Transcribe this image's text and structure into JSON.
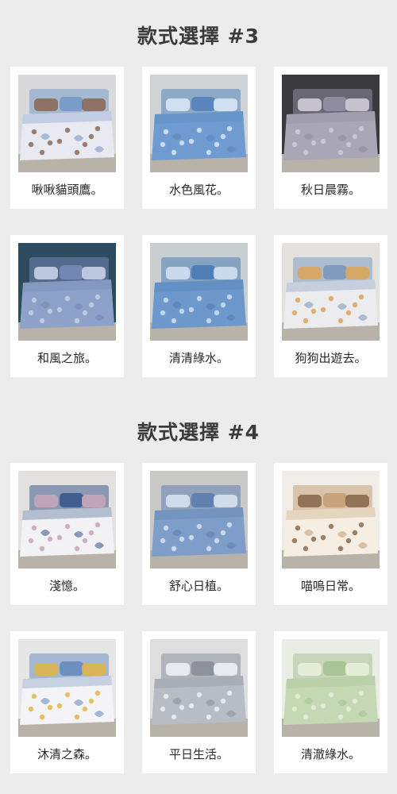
{
  "sections": [
    {
      "title": "款式選擇 #3",
      "items": [
        {
          "name": "啾啾貓頭鷹。",
          "colors": {
            "wall": "#d9d9dc",
            "bed": "#e9e9f1",
            "accent": "#7a9cc8",
            "pattern": "#8b6a5a"
          }
        },
        {
          "name": "水色風花。",
          "colors": {
            "wall": "#cfd3d6",
            "bed": "#6f9bd0",
            "accent": "#5a86bd",
            "pattern": "#d8e6f4"
          }
        },
        {
          "name": "秋日晨霧。",
          "colors": {
            "wall": "#3a3a3c",
            "bed": "#a9a6b6",
            "accent": "#8f8ca0",
            "pattern": "#cfccd8"
          }
        },
        {
          "name": "和風之旅。",
          "colors": {
            "wall": "#2e4a5e",
            "bed": "#8ea2c9",
            "accent": "#7387b3",
            "pattern": "#c6d1e6"
          }
        },
        {
          "name": "清清綠水。",
          "colors": {
            "wall": "#c9cfd0",
            "bed": "#6c98cc",
            "accent": "#4f7db5",
            "pattern": "#cfe0f0"
          }
        },
        {
          "name": "狗狗出遊去。",
          "colors": {
            "wall": "#e4e2df",
            "bed": "#ecebee",
            "accent": "#7f9cc0",
            "pattern": "#d9a55c"
          }
        }
      ]
    },
    {
      "title": "款式選擇 #4",
      "items": [
        {
          "name": "淺憶。",
          "colors": {
            "wall": "#e3e1df",
            "bed": "#f2f2f4",
            "accent": "#3f5e8f",
            "pattern": "#c7a6ba"
          }
        },
        {
          "name": "舒心日植。",
          "colors": {
            "wall": "#c9c9c7",
            "bed": "#7e9ec9",
            "accent": "#5f80b0",
            "pattern": "#d8e2ef"
          }
        },
        {
          "name": "喵嗚日常。",
          "colors": {
            "wall": "#f0ece6",
            "bed": "#f6eee2",
            "accent": "#c7a27a",
            "pattern": "#8a6a4f"
          }
        },
        {
          "name": "沐清之森。",
          "colors": {
            "wall": "#e6e6e6",
            "bed": "#f4f4f6",
            "accent": "#6c8fbf",
            "pattern": "#e0b54a"
          }
        },
        {
          "name": "平日生活。",
          "colors": {
            "wall": "#dedede",
            "bed": "#b8bcc4",
            "accent": "#8d929c",
            "pattern": "#eef0f3"
          }
        },
        {
          "name": "清澈綠水。",
          "colors": {
            "wall": "#eaece6",
            "bed": "#c4d8b4",
            "accent": "#a9c496",
            "pattern": "#e7efdc"
          }
        }
      ]
    }
  ]
}
